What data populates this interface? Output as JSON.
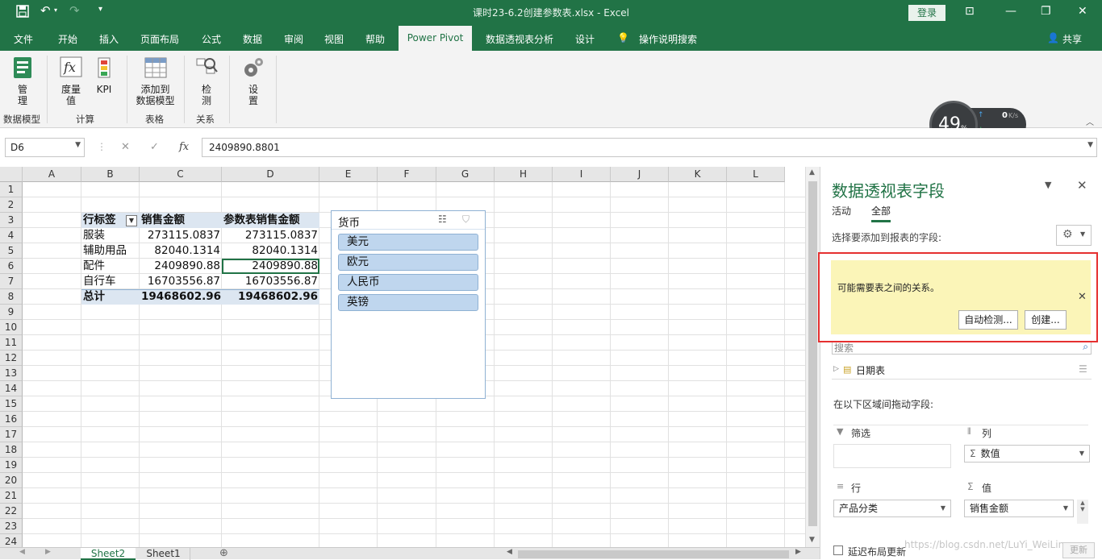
{
  "window": {
    "title": "课时23-6.2创建参数表.xlsx  -  Excel",
    "login": "登录"
  },
  "ribbon_tabs": [
    "文件",
    "开始",
    "插入",
    "页面布局",
    "公式",
    "数据",
    "审阅",
    "视图",
    "帮助",
    "Power Pivot",
    "数据透视表分析",
    "设计"
  ],
  "ribbon_extra": {
    "tellme": "操作说明搜索",
    "share": "共享"
  },
  "ribbon": {
    "buttons": {
      "manage": "管\n理",
      "measure": "度量\n值",
      "kpi": "KPI",
      "add_model": "添加到\n数据模型",
      "detect": "检\n测",
      "settings": "设\n置"
    },
    "groups": {
      "datamodel": "数据模型",
      "calc": "计算",
      "table": "表格",
      "relation": "关系"
    }
  },
  "net_widget": {
    "percent": "49",
    "unit": "%",
    "up": "0",
    "down": "0",
    "rate_unit": "K/s"
  },
  "formula_bar": {
    "name_box": "D6",
    "fx": "fx",
    "value": "2409890.8801"
  },
  "grid": {
    "columns": [
      "A",
      "B",
      "C",
      "D",
      "E",
      "F",
      "G",
      "H",
      "I",
      "J",
      "K",
      "L"
    ],
    "rows": [
      "1",
      "2",
      "3",
      "4",
      "5",
      "6",
      "7",
      "8",
      "9",
      "10",
      "11",
      "12",
      "13",
      "14",
      "15",
      "16",
      "17",
      "18",
      "19",
      "20",
      "21",
      "22",
      "23",
      "24"
    ]
  },
  "pivot": {
    "headers": [
      "行标签",
      "销售金额",
      "参数表销售金额"
    ],
    "rows": [
      [
        "服装",
        "273115.0837",
        "273115.0837"
      ],
      [
        "辅助用品",
        "82040.1314",
        "82040.1314"
      ],
      [
        "配件",
        "2409890.88",
        "2409890.88"
      ],
      [
        "自行车",
        "16703556.87",
        "16703556.87"
      ]
    ],
    "total": [
      "总计",
      "19468602.96",
      "19468602.96"
    ]
  },
  "slicer": {
    "title": "货币",
    "items": [
      "美元",
      "欧元",
      "人民币",
      "英镑"
    ]
  },
  "pane": {
    "title": "数据透视表字段",
    "tab_active": "活动",
    "tab_all": "全部",
    "choose_label": "选择要添加到报表的字段:",
    "warning": "可能需要表之间的关系。",
    "auto_detect": "自动检测...",
    "create": "创建...",
    "search_placeholder": "搜索",
    "field_item": "日期表",
    "drag_label": "在以下区域间拖动字段:",
    "filter_label": "筛选",
    "columns_label": "列",
    "rows_label": "行",
    "values_label": "值",
    "columns_value": "数值",
    "rows_value": "产品分类",
    "values_value": "销售金额",
    "defer_label": "延迟布局更新",
    "update": "更新"
  },
  "sheets": [
    "Sheet2",
    "Sheet1"
  ],
  "watermark": "https://blog.csdn.net/LuYi_WeiLin"
}
